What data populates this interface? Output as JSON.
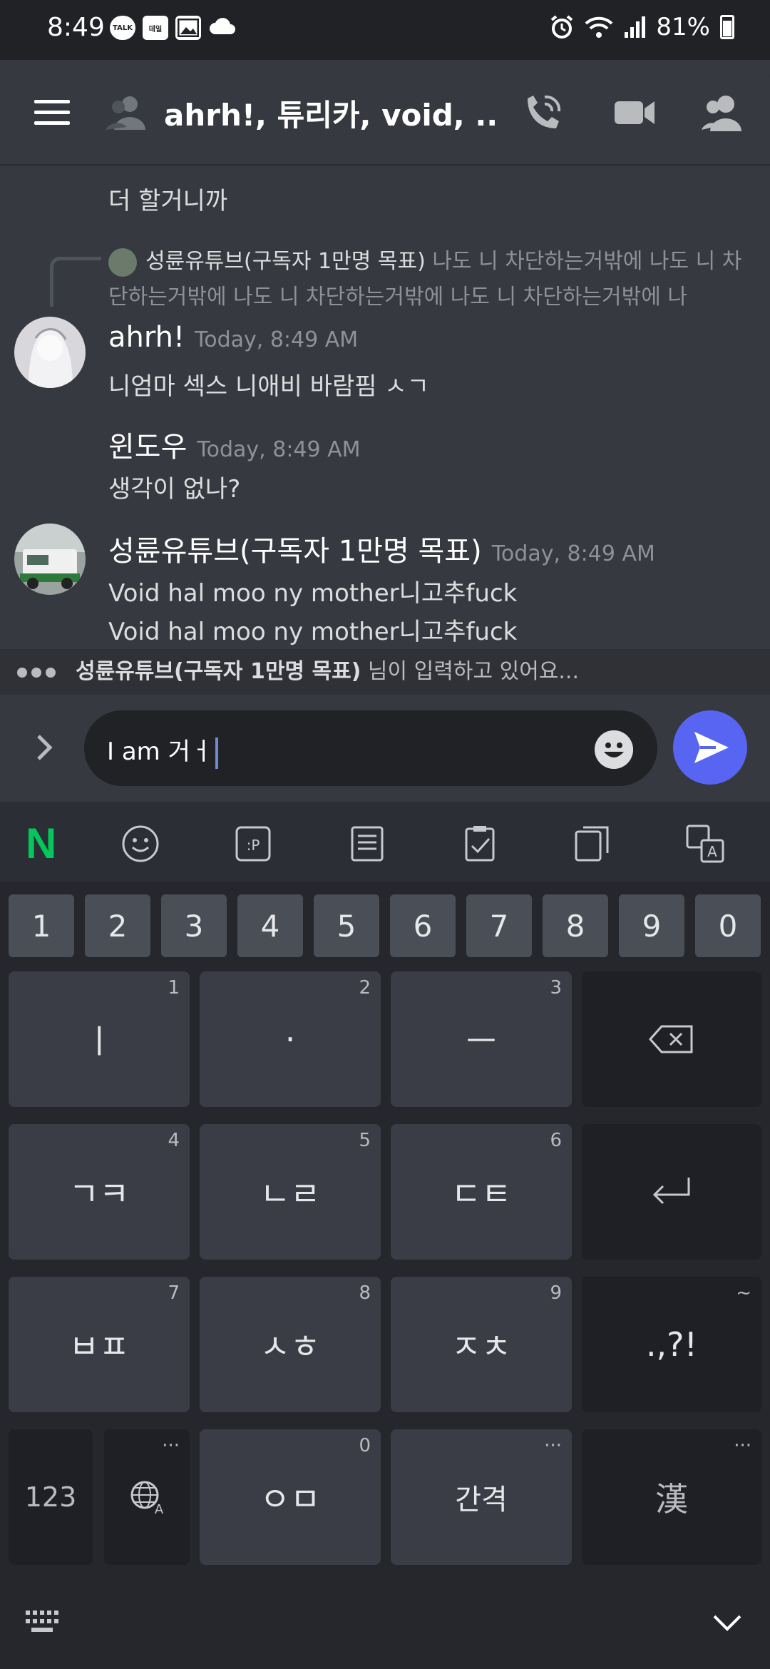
{
  "status": {
    "time": "8:49",
    "battery": "81%",
    "notif1": "TALK",
    "notif2": "데일"
  },
  "header": {
    "title": "ahrh!, 튜리카, void, ..."
  },
  "messages": {
    "cont_text": "더 할거니까",
    "reply": {
      "author": "성륜유튜브(구독자 1만명 목표)",
      "preview": "나도 니 차단하는거밖에 나도 니 차단하는거밖에 나도 니 차단하는거밖에 나도 니 차단하는거밖에 나"
    },
    "m1": {
      "author": "ahrh!",
      "time": "Today, 8:49 AM",
      "text": "니엄마 섹스 니애비 바람핌 ㅅㄱ"
    },
    "m2": {
      "author": "윈도우",
      "time": "Today, 8:49 AM",
      "text": "생각이 없나?"
    },
    "m3": {
      "author": "성륜유튜브(구독자 1만명 목표)",
      "time": "Today, 8:49 AM",
      "line1": "Void hal moo ny mother니고추fuck",
      "line2": "Void hal moo ny mother니고추fuck"
    }
  },
  "typing": {
    "user": "성륜유튜브(구독자 1만명 목표)",
    "suffix": " 님이 입력하고 있어요..."
  },
  "input": {
    "value": "I am 거ㅓ"
  },
  "keyboard": {
    "numbers": [
      "1",
      "2",
      "3",
      "4",
      "5",
      "6",
      "7",
      "8",
      "9",
      "0"
    ],
    "row1": [
      {
        "label": "ㅣ",
        "sub": "1"
      },
      {
        "label": "·",
        "sub": "2"
      },
      {
        "label": "ㅡ",
        "sub": "3"
      }
    ],
    "row2": [
      {
        "label": "ㄱㅋ",
        "sub": "4"
      },
      {
        "label": "ㄴㄹ",
        "sub": "5"
      },
      {
        "label": "ㄷㅌ",
        "sub": "6"
      }
    ],
    "row3": [
      {
        "label": "ㅂㅍ",
        "sub": "7"
      },
      {
        "label": "ㅅㅎ",
        "sub": "8"
      },
      {
        "label": "ㅈㅊ",
        "sub": "9"
      }
    ],
    "punct": ".,?!",
    "punct_sub": "~",
    "sym": "123",
    "om": "ㅇㅁ",
    "om_sub": "0",
    "space": "간격",
    "hanja": "漢",
    "more": "···",
    "naver": "N"
  }
}
